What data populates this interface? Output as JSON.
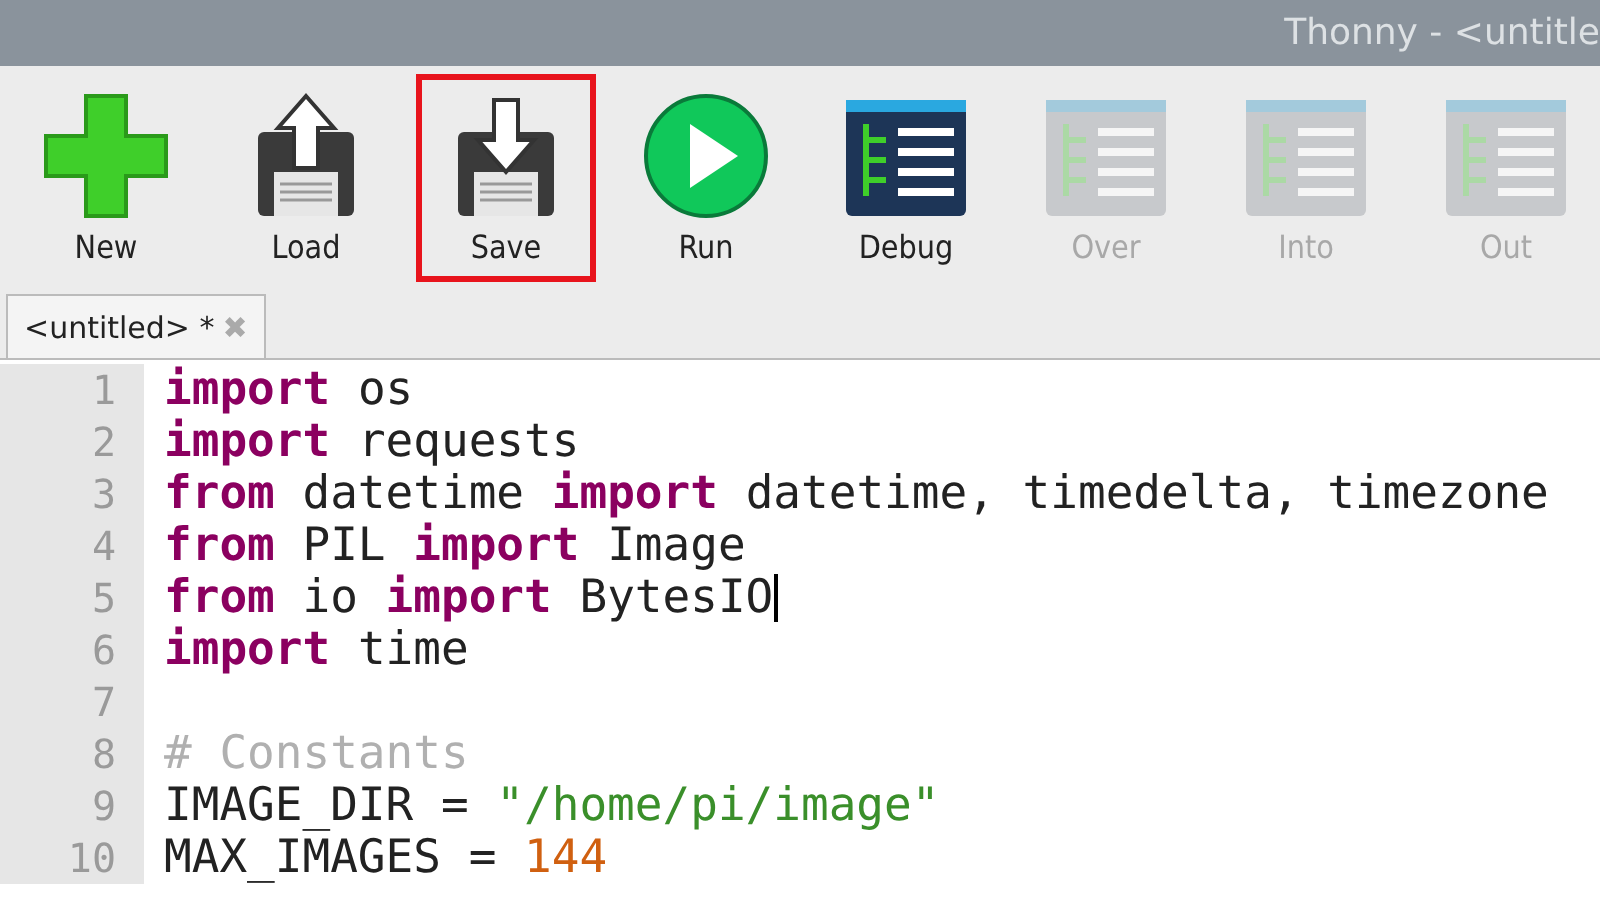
{
  "window": {
    "title": "Thonny - <untitle"
  },
  "toolbar": [
    {
      "label": "New",
      "kind": "new",
      "disabled": false,
      "highlighted": false
    },
    {
      "label": "Load",
      "kind": "load",
      "disabled": false,
      "highlighted": false
    },
    {
      "label": "Save",
      "kind": "save",
      "disabled": false,
      "highlighted": true
    },
    {
      "label": "Run",
      "kind": "run",
      "disabled": false,
      "highlighted": false
    },
    {
      "label": "Debug",
      "kind": "debug",
      "disabled": false,
      "highlighted": false
    },
    {
      "label": "Over",
      "kind": "over",
      "disabled": true,
      "highlighted": false
    },
    {
      "label": "Into",
      "kind": "into",
      "disabled": true,
      "highlighted": false
    },
    {
      "label": "Out",
      "kind": "out",
      "disabled": true,
      "highlighted": false
    }
  ],
  "tabs": [
    {
      "label": "<untitled> *",
      "close": "✖",
      "selected": true
    }
  ],
  "editor": {
    "lines": [
      {
        "number": "1",
        "cursor": false,
        "tokens": [
          {
            "kind": "keyword",
            "text": "import"
          },
          {
            "kind": "plain",
            "text": " os"
          }
        ]
      },
      {
        "number": "2",
        "cursor": false,
        "tokens": [
          {
            "kind": "keyword",
            "text": "import"
          },
          {
            "kind": "plain",
            "text": " requests"
          }
        ]
      },
      {
        "number": "3",
        "cursor": false,
        "tokens": [
          {
            "kind": "keyword",
            "text": "from"
          },
          {
            "kind": "plain",
            "text": " datetime "
          },
          {
            "kind": "keyword",
            "text": "import"
          },
          {
            "kind": "plain",
            "text": " datetime, timedelta, timezone"
          }
        ]
      },
      {
        "number": "4",
        "cursor": false,
        "tokens": [
          {
            "kind": "keyword",
            "text": "from"
          },
          {
            "kind": "plain",
            "text": " PIL "
          },
          {
            "kind": "keyword",
            "text": "import"
          },
          {
            "kind": "plain",
            "text": " Image"
          }
        ]
      },
      {
        "number": "5",
        "cursor": true,
        "tokens": [
          {
            "kind": "keyword",
            "text": "from"
          },
          {
            "kind": "plain",
            "text": " io "
          },
          {
            "kind": "keyword",
            "text": "import"
          },
          {
            "kind": "plain",
            "text": " BytesIO"
          }
        ]
      },
      {
        "number": "6",
        "cursor": false,
        "tokens": [
          {
            "kind": "keyword",
            "text": "import"
          },
          {
            "kind": "plain",
            "text": " time"
          }
        ]
      },
      {
        "number": "7",
        "cursor": false
      },
      {
        "number": "8",
        "cursor": false,
        "tokens": [
          {
            "kind": "comment",
            "text": "# Constants"
          }
        ]
      },
      {
        "number": "9",
        "cursor": false,
        "tokens": [
          {
            "kind": "plain",
            "text": "IMAGE_DIR = "
          },
          {
            "kind": "string",
            "text": "\"/home/pi/image\""
          }
        ]
      },
      {
        "number": "10",
        "cursor": false,
        "tokens": [
          {
            "kind": "plain",
            "text": "MAX_IMAGES = "
          },
          {
            "kind": "number",
            "text": "144"
          }
        ]
      }
    ]
  }
}
